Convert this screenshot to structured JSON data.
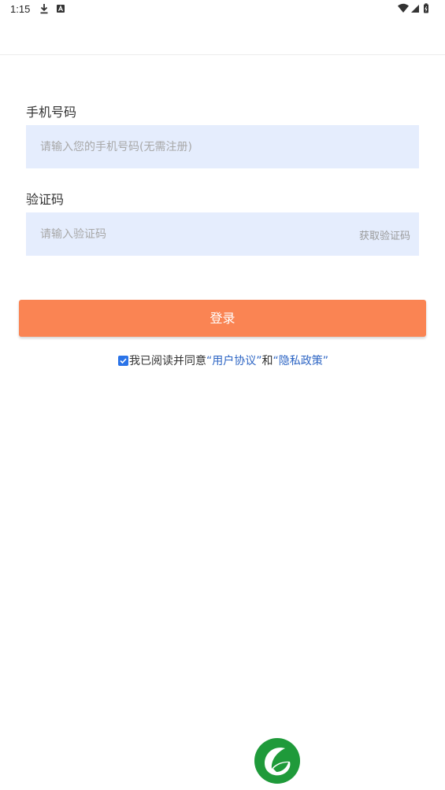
{
  "status_bar": {
    "time": "1:15",
    "icons": [
      "download-icon",
      "a-notification-icon",
      "wifi-icon",
      "signal-icon",
      "battery-icon"
    ]
  },
  "form": {
    "phone_label": "手机号码",
    "phone_placeholder": "请输入您的手机号码(无需注册)",
    "code_label": "验证码",
    "code_placeholder": "请输入验证码",
    "get_code": "获取验证码"
  },
  "login_button": "登录",
  "agreement": {
    "checked": true,
    "prefix": "我已阅读并同意",
    "user_agreement": "“用户协议”",
    "and": "和",
    "privacy_policy": "“隐私政策”"
  },
  "colors": {
    "field_bg": "#e5edfd",
    "login_button": "#fa8453",
    "link": "#2d65c4",
    "checkbox": "#2a73e8",
    "logo_green": "#1f9a3a"
  }
}
